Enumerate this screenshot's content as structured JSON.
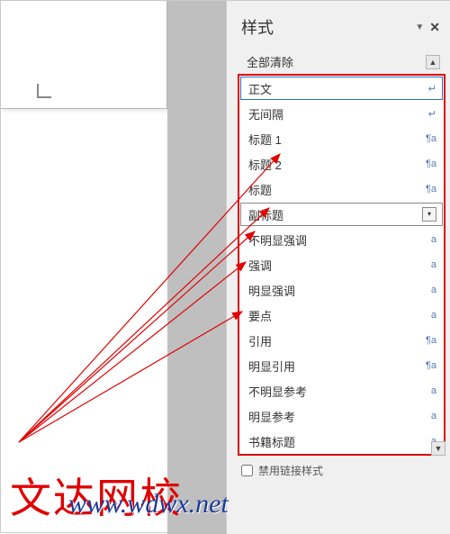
{
  "panel": {
    "title": "样式",
    "clear_all": "全部清除",
    "disable_linked_styles": "禁用链接样式"
  },
  "styles": [
    {
      "label": "正文",
      "marker": "↵",
      "cls": "selected"
    },
    {
      "label": "无间隔",
      "marker": "↵",
      "cls": ""
    },
    {
      "label": "标题 1",
      "marker": "¶a",
      "cls": ""
    },
    {
      "label": "标题 2",
      "marker": "¶a",
      "cls": ""
    },
    {
      "label": "标题",
      "marker": "¶a",
      "cls": ""
    },
    {
      "label": "副标题",
      "marker": "",
      "cls": "boxed",
      "dropdown": true
    },
    {
      "label": "不明显强调",
      "marker": "a",
      "cls": ""
    },
    {
      "label": "强调",
      "marker": "a",
      "cls": ""
    },
    {
      "label": "明显强调",
      "marker": "a",
      "cls": ""
    },
    {
      "label": "要点",
      "marker": "a",
      "cls": ""
    },
    {
      "label": "引用",
      "marker": "¶a",
      "cls": ""
    },
    {
      "label": "明显引用",
      "marker": "¶a",
      "cls": ""
    },
    {
      "label": "不明显参考",
      "marker": "a",
      "cls": ""
    },
    {
      "label": "明显参考",
      "marker": "a",
      "cls": ""
    },
    {
      "label": "书籍标题",
      "marker": "a",
      "cls": ""
    }
  ],
  "watermark": {
    "main": "文达网校",
    "url": "www.wdwx.net"
  }
}
